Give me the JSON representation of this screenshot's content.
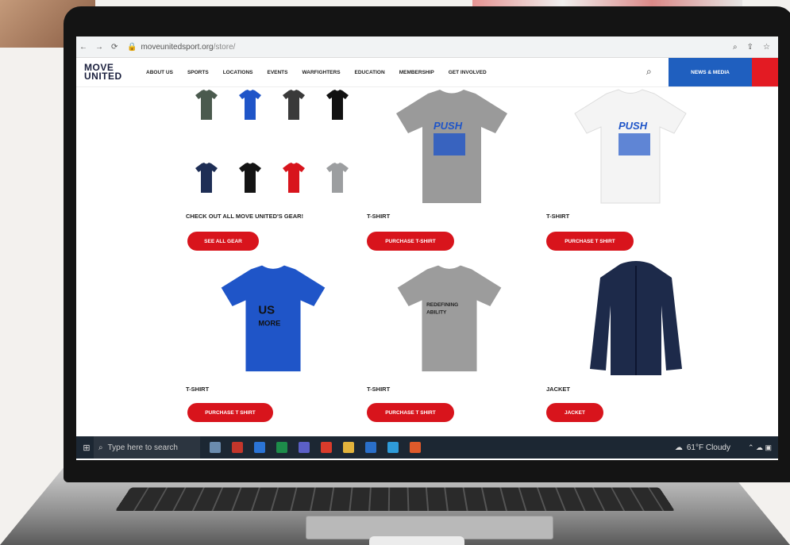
{
  "browser": {
    "url_host": "moveunitedsport.org",
    "url_path": "/store/"
  },
  "site": {
    "logo_line1": "MOVE",
    "logo_line2": "UNITED",
    "nav": [
      "ABOUT US",
      "SPORTS",
      "LOCATIONS",
      "EVENTS",
      "WARFIGHTERS",
      "EDUCATION",
      "MEMBERSHIP",
      "GET INVOLVED"
    ],
    "news_button": "NEWS & MEDIA"
  },
  "products": [
    {
      "title": "CHECK OUT ALL MOVE UNITED'S GEAR!",
      "button": "SEE ALL GEAR",
      "color": "#555"
    },
    {
      "title": "T-SHIRT",
      "button": "PURCHASE T-SHIRT",
      "color": "#9a9a9a",
      "print": "PUSH"
    },
    {
      "title": "T-SHIRT",
      "button": "PURCHASE T SHIRT",
      "color": "#f4f4f4",
      "print": "PUSH"
    },
    {
      "title": "T-SHIRT",
      "button": "PURCHASE T SHIRT",
      "color": "#1f55c8",
      "print": "US MORE"
    },
    {
      "title": "T-SHIRT",
      "button": "PURCHASE T SHIRT",
      "color": "#9c9c9c",
      "print": "REDEFINING ABILITY"
    },
    {
      "title": "JACKET",
      "button": "JACKET",
      "color": "#1d2a4a",
      "print": ""
    }
  ],
  "mini_colors": [
    "#4a5a4e",
    "#1f55c8",
    "#3a3a3a",
    "#111111",
    "#1e2e55",
    "#141414",
    "#d8141c",
    "#9c9ea0"
  ],
  "taskbar": {
    "search_placeholder": "Type here to search",
    "weather": "61°F  Cloudy"
  }
}
